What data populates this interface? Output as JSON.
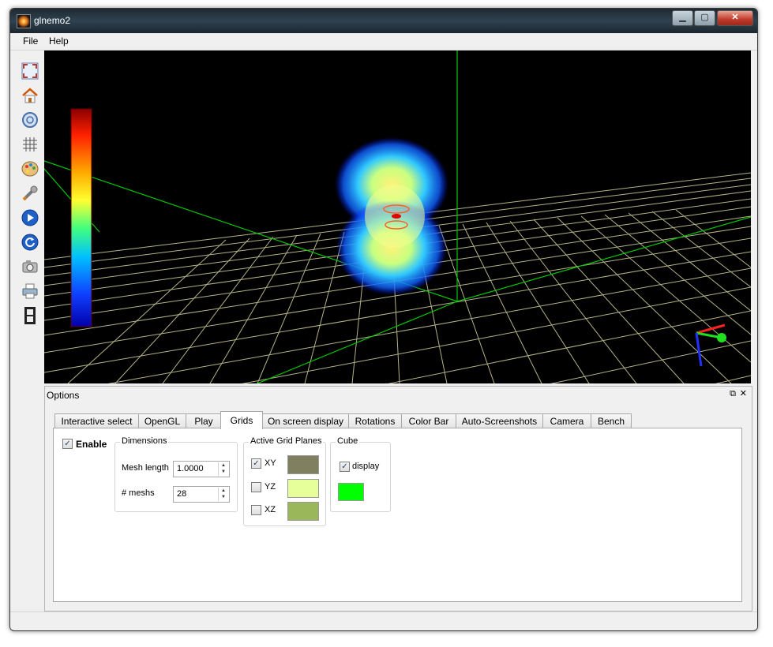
{
  "window": {
    "title": "glnemo2"
  },
  "menu": {
    "items": [
      "File",
      "Help"
    ]
  },
  "toolbar": {
    "tools": [
      {
        "name": "fullscreen-icon",
        "glyph": "⛶"
      },
      {
        "name": "home-icon",
        "glyph": "⌂"
      },
      {
        "name": "zoom-icon",
        "glyph": "🔍"
      },
      {
        "name": "grid-icon",
        "glyph": "#"
      },
      {
        "name": "palette-icon",
        "glyph": "🎨"
      },
      {
        "name": "wrench-icon",
        "glyph": "🔧"
      },
      {
        "name": "play-icon",
        "glyph": "▶"
      },
      {
        "name": "reload-icon",
        "glyph": "↻"
      },
      {
        "name": "camera-icon",
        "glyph": "📷"
      },
      {
        "name": "printer-icon",
        "glyph": "🖨"
      },
      {
        "name": "film-icon",
        "glyph": "🎞"
      }
    ]
  },
  "viewport": {
    "background": "#000000",
    "grid_color": "#c8c896",
    "axis_color": "#00c800",
    "colorbar_top": "#8b0000",
    "colorbar_bottom": "#0000aa"
  },
  "options": {
    "title": "Options",
    "tabs": [
      "Interactive select",
      "OpenGL",
      "Play",
      "Grids",
      "On screen display",
      "Rotations",
      "Color Bar",
      "Auto-Screenshots",
      "Camera",
      "Bench"
    ],
    "active_tab": "Grids",
    "enable": {
      "label": "Enable",
      "checked": true
    },
    "dimensions": {
      "title": "Dimensions",
      "mesh_length_label": "Mesh length",
      "mesh_length_value": "1.0000",
      "meshs_label": "# meshs",
      "meshs_value": "28"
    },
    "planes": {
      "title": "Active Grid Planes",
      "items": [
        {
          "label": "XY",
          "checked": true,
          "color": "#808060"
        },
        {
          "label": "YZ",
          "checked": false,
          "color": "#e6ff9a"
        },
        {
          "label": "XZ",
          "checked": false,
          "color": "#9ab85a"
        }
      ]
    },
    "cube": {
      "title": "Cube",
      "display_label": "display",
      "checked": true,
      "color": "#00ff00"
    }
  }
}
